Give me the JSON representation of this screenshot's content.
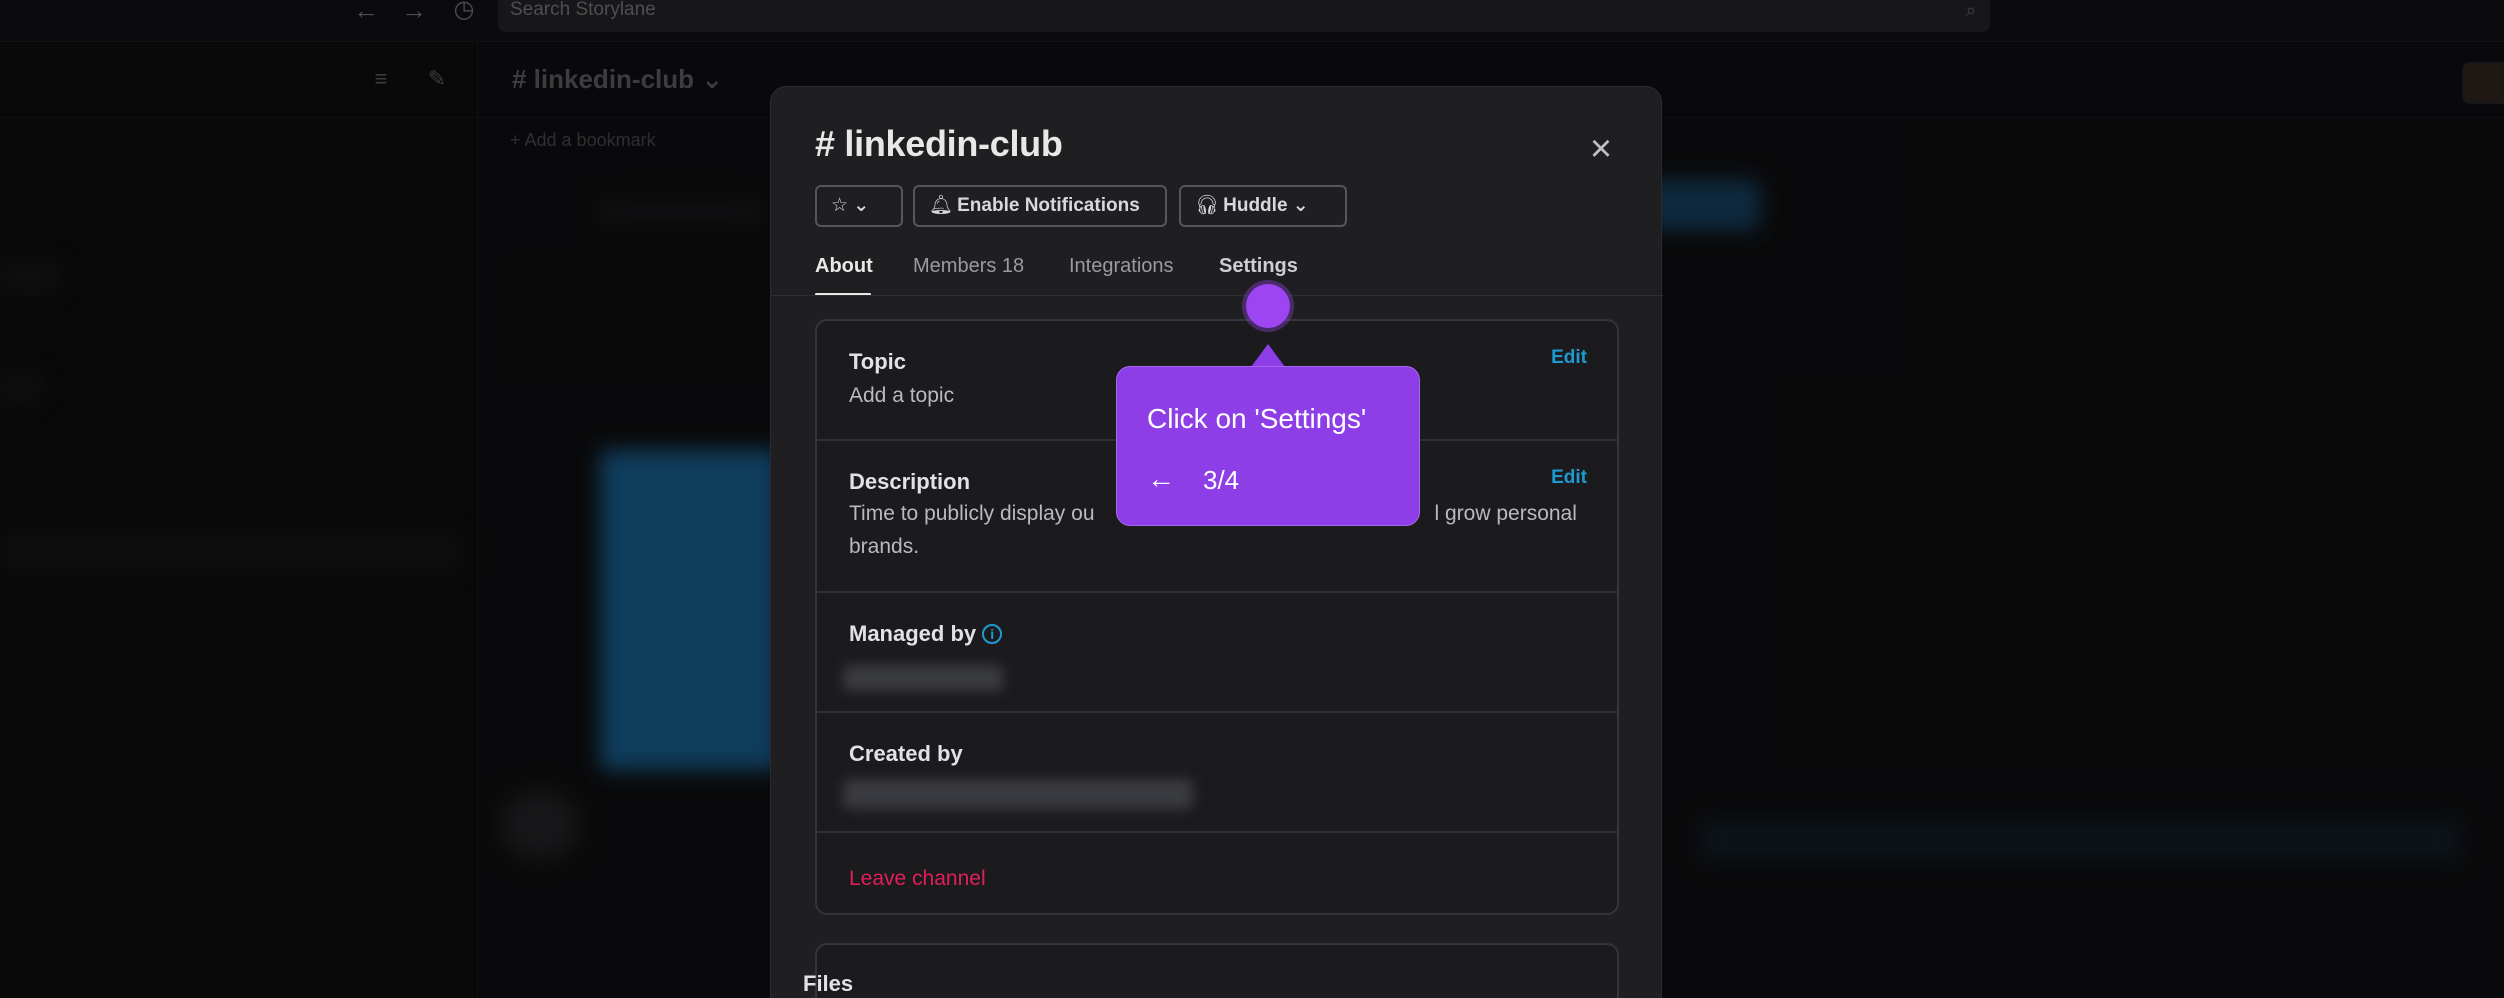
{
  "topbar": {
    "back_icon": "arrow-left-icon",
    "forward_icon": "arrow-right-icon",
    "history_icon": "clock-icon",
    "search_placeholder": "Search Storylane",
    "search_icon": "search-icon"
  },
  "sidebar": {
    "filter_icon": "filter-icon",
    "compose_icon": "compose-icon"
  },
  "channel_header": {
    "title": "# linkedin-club ⌄",
    "bookmark": "+ Add a bookmark"
  },
  "modal": {
    "title": "# linkedin-club",
    "close_icon": "close-icon",
    "star_button": "☆ ⌄",
    "notifications_button": "Enable Notifications",
    "huddle_button": "Huddle ⌄",
    "tabs": [
      {
        "label": "About"
      },
      {
        "label": "Members 18"
      },
      {
        "label": "Integrations"
      },
      {
        "label": "Settings"
      }
    ],
    "topic": {
      "label": "Topic",
      "value": "Add a topic",
      "edit": "Edit"
    },
    "description": {
      "label": "Description",
      "value_start": "Time to publicly display ou",
      "value_end": "l grow personal",
      "value_line2": "brands.",
      "edit": "Edit"
    },
    "managed_by": {
      "label": "Managed by",
      "info_icon": "info-icon"
    },
    "created_by": {
      "label": "Created by"
    },
    "leave": "Leave channel",
    "files_label": "Files"
  },
  "tooltip": {
    "text": "Click on 'Settings'",
    "back_arrow": "←",
    "step": "3/4",
    "color": "#8e3ee6"
  }
}
